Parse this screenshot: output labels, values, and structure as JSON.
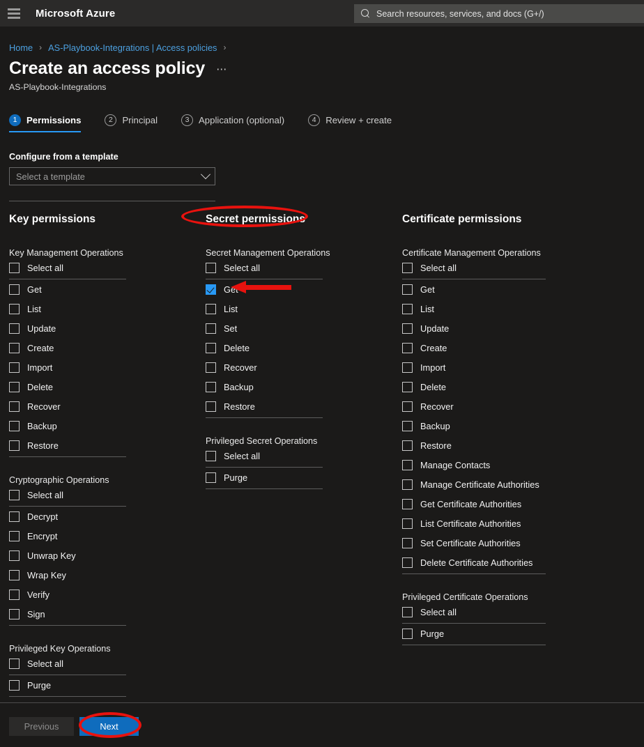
{
  "topbar": {
    "menu_icon": "hamburger-icon",
    "brand": "Microsoft Azure",
    "search_placeholder": "Search resources, services, and docs (G+/)",
    "search_icon": "search-icon"
  },
  "breadcrumb": {
    "items": [
      "Home",
      "AS-Playbook-Integrations | Access policies"
    ],
    "separator": "›"
  },
  "header": {
    "title": "Create an access policy",
    "more_label": "⋯",
    "subtitle": "AS-Playbook-Integrations"
  },
  "steps": [
    {
      "number": "1",
      "label": "Permissions",
      "active": true
    },
    {
      "number": "2",
      "label": "Principal",
      "active": false
    },
    {
      "number": "3",
      "label": "Application (optional)",
      "active": false
    },
    {
      "number": "4",
      "label": "Review + create",
      "active": false
    }
  ],
  "template": {
    "label": "Configure from a template",
    "value": "Select a template",
    "chevron_icon": "chevron-down-icon"
  },
  "columns": [
    {
      "title": "Key permissions",
      "groups": [
        {
          "title": "Key Management Operations",
          "select_all": "Select all",
          "items": [
            "Get",
            "List",
            "Update",
            "Create",
            "Import",
            "Delete",
            "Recover",
            "Backup",
            "Restore"
          ],
          "checked": []
        },
        {
          "title": "Cryptographic Operations",
          "select_all": "Select all",
          "items": [
            "Decrypt",
            "Encrypt",
            "Unwrap Key",
            "Wrap Key",
            "Verify",
            "Sign"
          ],
          "checked": []
        },
        {
          "title": "Privileged Key Operations",
          "select_all": "Select all",
          "items": [
            "Purge"
          ],
          "checked": []
        }
      ]
    },
    {
      "title": "Secret permissions",
      "groups": [
        {
          "title": "Secret Management Operations",
          "select_all": "Select all",
          "items": [
            "Get",
            "List",
            "Set",
            "Delete",
            "Recover",
            "Backup",
            "Restore"
          ],
          "checked": [
            "Get"
          ]
        },
        {
          "title": "Privileged Secret Operations",
          "select_all": "Select all",
          "items": [
            "Purge"
          ],
          "checked": []
        }
      ]
    },
    {
      "title": "Certificate permissions",
      "groups": [
        {
          "title": "Certificate Management Operations",
          "select_all": "Select all",
          "items": [
            "Get",
            "List",
            "Update",
            "Create",
            "Import",
            "Delete",
            "Recover",
            "Backup",
            "Restore",
            "Manage Contacts",
            "Manage Certificate Authorities",
            "Get Certificate Authorities",
            "List Certificate Authorities",
            "Set Certificate Authorities",
            "Delete Certificate Authorities"
          ],
          "checked": []
        },
        {
          "title": "Privileged Certificate Operations",
          "select_all": "Select all",
          "items": [
            "Purge"
          ],
          "checked": []
        }
      ]
    }
  ],
  "footer": {
    "previous_label": "Previous",
    "next_label": "Next"
  },
  "annotations": {
    "color": "#e8120e",
    "ellipse_secret_permissions": "Secret permissions",
    "ellipse_next_button": "Next",
    "arrow_points_to": "Get"
  },
  "colors": {
    "accent_blue": "#0f6cbd",
    "checkbox_blue": "#2899f5",
    "link_blue": "#4ca0e0",
    "page_bg": "#1b1a19",
    "topbar_bg": "#2b2a29"
  }
}
